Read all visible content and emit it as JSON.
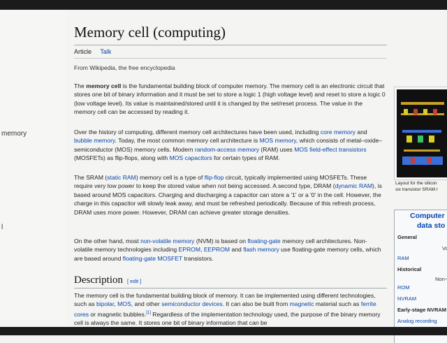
{
  "article": {
    "title": "Memory cell (computing)",
    "tabs": [
      "Article",
      "Talk"
    ],
    "from": "From Wikipedia, the free encyclopedia"
  },
  "left_gutter": [
    "memory",
    "l"
  ],
  "paragraphs": {
    "p1": {
      "lead": "The ",
      "bold": "memory cell",
      "a": " is the fundamental building block of computer memory. The memory cell is an electronic circuit that stores one bit of binary information and it must be set to store a logic 1 (high voltage level) and reset to store a logic 0 (low voltage level). Its value is maintained/stored until it is changed by the set/reset process. The value in the memory cell can be accessed by reading it."
    },
    "p2": {
      "a": "Over the history of computing, different memory cell architectures have been used, including ",
      "l1": "core memory",
      "b": " and ",
      "l2": "bubble memory",
      "c": ". Today, the most common memory cell architecture is ",
      "l3": "MOS memory",
      "d": ", which consists of metal–oxide–semiconductor (MOS) memory cells. Modern ",
      "l4": "random-access memory",
      "e": " (RAM) uses ",
      "l5": "MOS field-effect transistors",
      "f": " (MOSFETs) as flip-flops, along with ",
      "l6": "MOS capacitors",
      "g": " for certain types of RAM."
    },
    "p3": {
      "a": "The SRAM (",
      "l1": "static RAM",
      "b": ") memory cell is a type of ",
      "l2": "flip-flop",
      "c": " circuit, typically implemented using MOSFETs. These require very low power to keep the stored value when not being accessed. A second type, DRAM (",
      "l3": "dynamic RAM",
      "d": "), is based around MOS capacitors. Charging and discharging a capacitor can store a '1' or a '0' in the cell. However, the charge in this capacitor will slowly leak away, and must be refreshed periodically. Because of this refresh process, DRAM uses more power. However, DRAM can achieve greater storage densities."
    },
    "p4": {
      "a": "On the other hand, most ",
      "l1": "non-volatile memory",
      "b": " (NVM) is based on ",
      "l2": "floating-gate",
      "c": " memory cell architectures. Non-volatile memory technologies including ",
      "l3": "EPROM",
      "d": ", ",
      "l4": "EEPROM",
      "e": " and ",
      "l5": "flash memory",
      "f": " use floating-gate memory cells, which are based around ",
      "l6": "floating-gate",
      "g": " ",
      "l7": "MOSFET",
      "h": " transistors."
    },
    "p5": {
      "a": "The memory cell is the fundamental building block of memory. It can be implemented using different technologies, such as ",
      "l1": "bipolar",
      "b": ", ",
      "l2": "MOS",
      "c": ", and other ",
      "l3": "semiconductor devices",
      "d": ". It can also be built from ",
      "l4": "magnetic",
      "e": " material such as ",
      "l5": "ferrite cores",
      "f": " or magnetic bubbles.",
      "sup": "[1]",
      "g": " Regardless of the implementation technology used, the purpose of the binary memory cell is always the same. It stores one bit of binary information that can be"
    }
  },
  "section": {
    "heading": "Description",
    "edit": "[ edit ]"
  },
  "thumb_caption": [
    "Layout for the silicon",
    "six transistor SRAM r"
  ],
  "infobox": {
    "title1": "Computer",
    "title2": "data sto",
    "general": "General",
    "vo": "Vo",
    "ram": "RAM",
    "historical": "Historical",
    "non_v": "Non-v",
    "rom": "ROM",
    "nvram": "NVRAM",
    "early_nvram": "Early-stage NVRAM",
    "analog": "Analog recording"
  },
  "colors": {
    "link": "#0645ad",
    "text": "#222222",
    "rule": "#a2a9b1"
  }
}
